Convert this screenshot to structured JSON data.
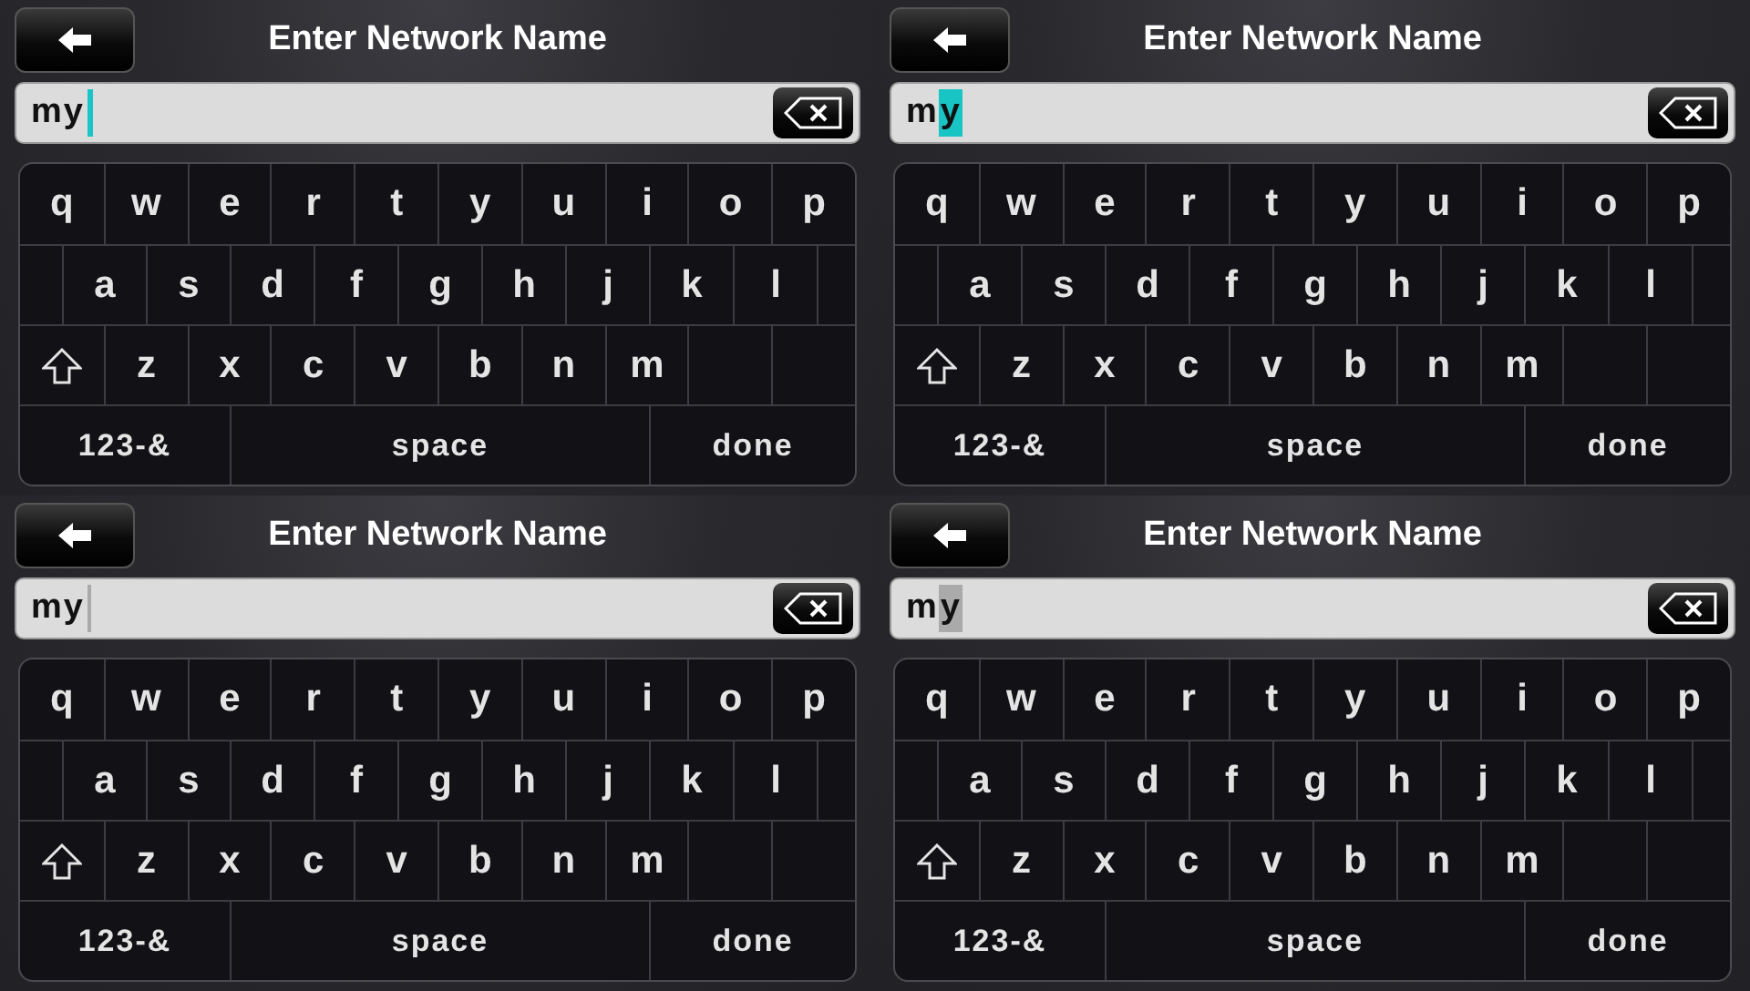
{
  "panels": [
    {
      "title": "Enter Network Name",
      "field": {
        "value": "my",
        "cursor": {
          "kind": "bar",
          "color": "#19c4c4"
        }
      },
      "keys": [
        [
          "q",
          "w",
          "e",
          "r",
          "t",
          "y",
          "u",
          "i",
          "o",
          "p"
        ],
        [
          "a",
          "s",
          "d",
          "f",
          "g",
          "h",
          "j",
          "k",
          "l"
        ],
        [
          "z",
          "x",
          "c",
          "v",
          "b",
          "n",
          "m"
        ],
        [
          "123-&",
          "space",
          "done"
        ]
      ]
    },
    {
      "title": "Enter Network Name",
      "field": {
        "value": "m",
        "selection": "y",
        "cursor": {
          "kind": "highlight",
          "color": "#19c4c4"
        }
      },
      "keys": [
        [
          "q",
          "w",
          "e",
          "r",
          "t",
          "y",
          "u",
          "i",
          "o",
          "p"
        ],
        [
          "a",
          "s",
          "d",
          "f",
          "g",
          "h",
          "j",
          "k",
          "l"
        ],
        [
          "z",
          "x",
          "c",
          "v",
          "b",
          "n",
          "m"
        ],
        [
          "123-&",
          "space",
          "done"
        ]
      ]
    },
    {
      "title": "Enter Network Name",
      "field": {
        "value": "my",
        "cursor": {
          "kind": "bar",
          "color": "#aaaaaa"
        }
      },
      "keys": [
        [
          "q",
          "w",
          "e",
          "r",
          "t",
          "y",
          "u",
          "i",
          "o",
          "p"
        ],
        [
          "a",
          "s",
          "d",
          "f",
          "g",
          "h",
          "j",
          "k",
          "l"
        ],
        [
          "z",
          "x",
          "c",
          "v",
          "b",
          "n",
          "m"
        ],
        [
          "123-&",
          "space",
          "done"
        ]
      ]
    },
    {
      "title": "Enter Network Name",
      "field": {
        "value": "m",
        "selection": "y",
        "cursor": {
          "kind": "highlight",
          "color": "#aaaaaa"
        }
      },
      "keys": [
        [
          "q",
          "w",
          "e",
          "r",
          "t",
          "y",
          "u",
          "i",
          "o",
          "p"
        ],
        [
          "a",
          "s",
          "d",
          "f",
          "g",
          "h",
          "j",
          "k",
          "l"
        ],
        [
          "z",
          "x",
          "c",
          "v",
          "b",
          "n",
          "m"
        ],
        [
          "123-&",
          "space",
          "done"
        ]
      ]
    }
  ]
}
